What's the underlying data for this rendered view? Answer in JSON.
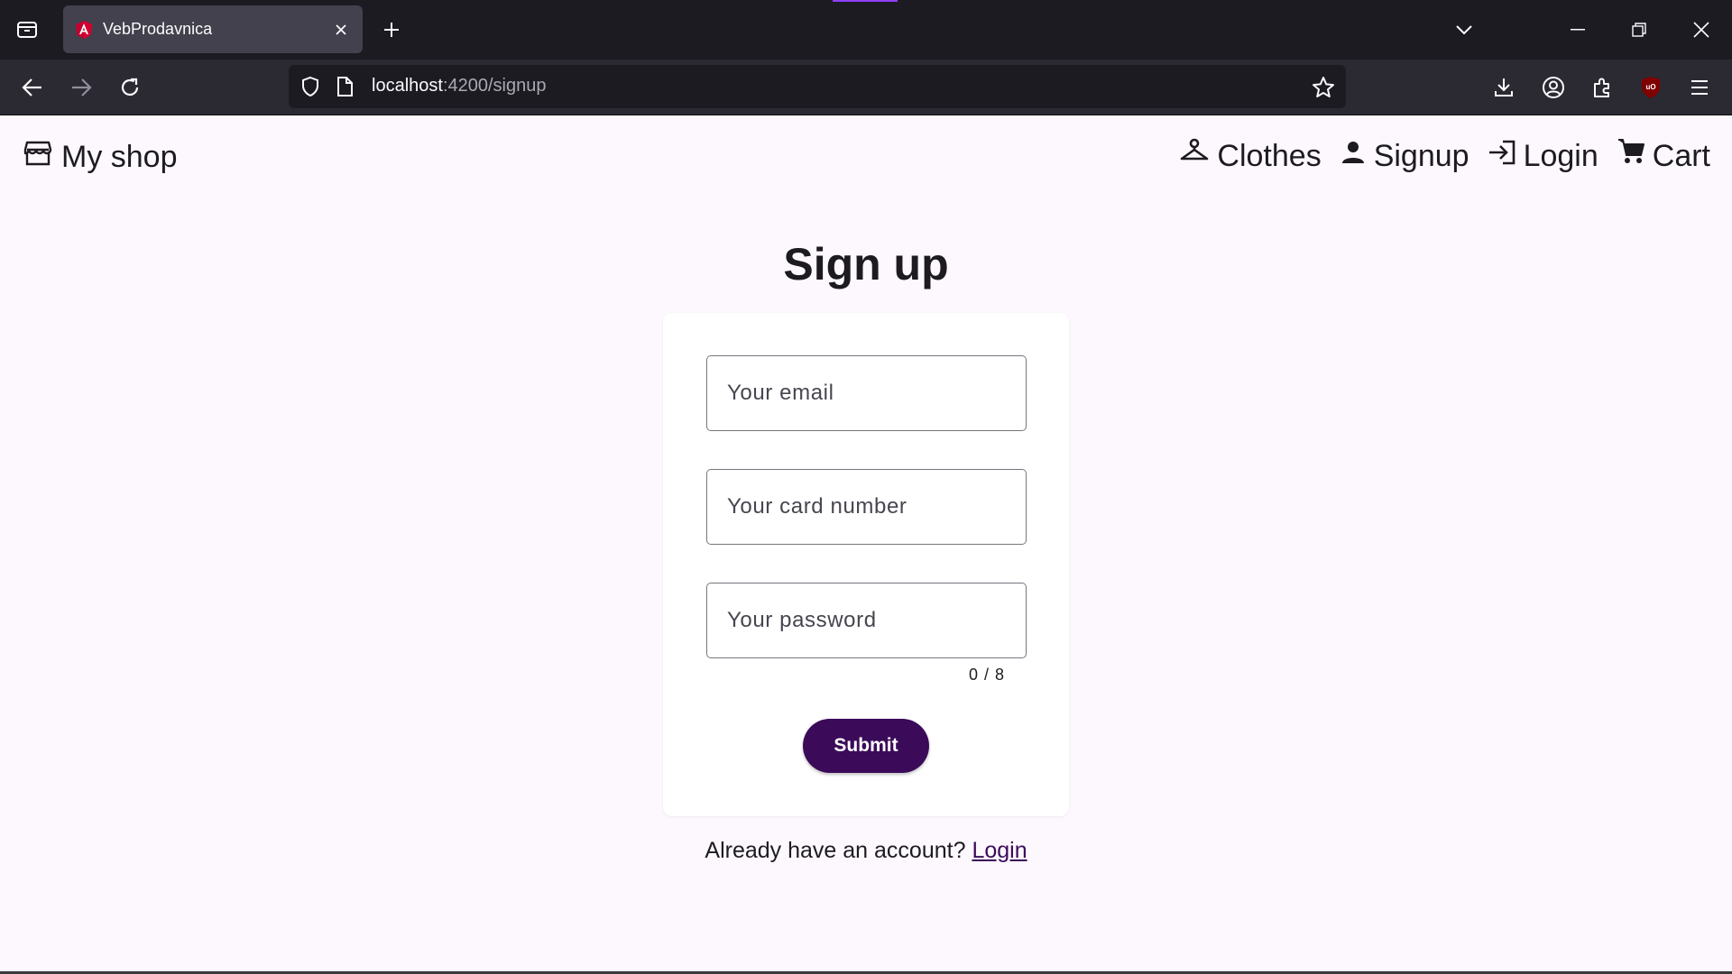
{
  "browser": {
    "tab_title": "VebProdavnica",
    "url_host": "localhost",
    "url_rest": ":4200/signup",
    "accent": "#8f3ff7"
  },
  "header": {
    "brand": "My shop",
    "nav": [
      {
        "label": "Clothes",
        "icon": "hanger-icon"
      },
      {
        "label": "Signup",
        "icon": "person-icon"
      },
      {
        "label": "Login",
        "icon": "login-icon"
      },
      {
        "label": "Cart",
        "icon": "cart-icon"
      }
    ]
  },
  "signup": {
    "title": "Sign up",
    "email_placeholder": "Your email",
    "card_placeholder": "Your card number",
    "password_placeholder": "Your password",
    "password_counter": "0 / 8",
    "submit_label": "Submit",
    "already_text": "Already have an account?",
    "login_link": "Login"
  },
  "colors": {
    "primary": "#3b0b5a",
    "background": "#fdf8fd"
  }
}
